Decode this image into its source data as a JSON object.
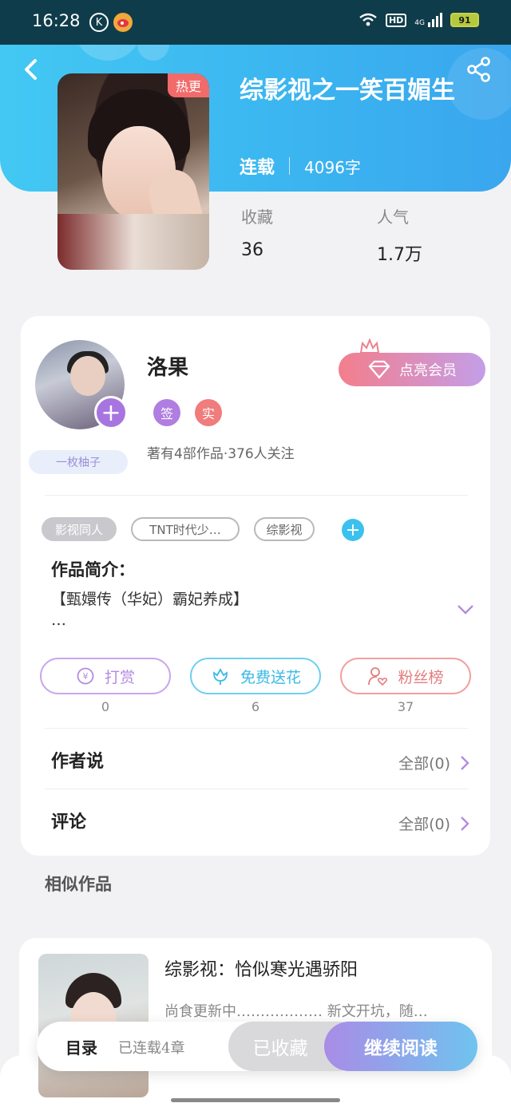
{
  "status_bar": {
    "time": "16:28",
    "network": "4G",
    "battery": "91"
  },
  "book": {
    "title": "综影视之一笑百媚生",
    "status": "连载",
    "word_count": "4096字",
    "hot_badge": "热更",
    "stats": [
      {
        "label": "收藏",
        "value": "36"
      },
      {
        "label": "人气",
        "value": "1.7万"
      }
    ]
  },
  "author": {
    "name": "洛果",
    "tag": "一枚柚子",
    "badges": [
      "签",
      "实"
    ],
    "stats_text": "著有4部作品·376人关注",
    "vip_button": "点亮会员"
  },
  "tags": [
    "影视同人",
    "TNT时代少…",
    "综影视"
  ],
  "intro": {
    "title": "作品简介：",
    "text_line1": "【甄嬛传（华妃）霸妃养成】",
    "text_line2": "…"
  },
  "actions": [
    {
      "label": "打赏",
      "count": "0",
      "color": "#b48be0"
    },
    {
      "label": "免费送花",
      "count": "6",
      "color": "#4cc3ea"
    },
    {
      "label": "粉丝榜",
      "count": "37",
      "color": "#ef8a8a"
    }
  ],
  "rows": [
    {
      "label": "作者说",
      "right": "全部(0)"
    },
    {
      "label": "评论",
      "right": "全部(0)"
    }
  ],
  "similar": {
    "section_title": "相似作品",
    "items": [
      {
        "title": "综影视：恰似寒光遇骄阳",
        "desc": "尚食更新中……………… 新文开坑，随…"
      }
    ]
  },
  "bottom_bar": {
    "toc": "目录",
    "chapters": "已连载4章",
    "collected": "已收藏",
    "continue": "继续阅读"
  },
  "colors": {
    "header": "#3bb4f0",
    "accent_purple": "#a875e0",
    "badge_sign": "#b07de0",
    "badge_real": "#f07c7c"
  }
}
